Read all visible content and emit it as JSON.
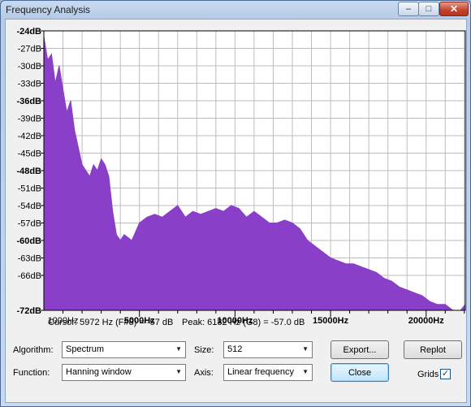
{
  "window": {
    "title": "Frequency Analysis",
    "min_glyph": "–",
    "max_glyph": "□",
    "close_glyph": "✕"
  },
  "chart_data": {
    "type": "area",
    "y_tick_labels": [
      "-24dB",
      "-27dB",
      "-30dB",
      "-33dB",
      "-36dB",
      "-39dB",
      "-42dB",
      "-45dB",
      "-48dB",
      "-51dB",
      "-54dB",
      "-57dB",
      "-60dB",
      "-63dB",
      "-66dB",
      "-72dB"
    ],
    "x_tick_labels": [
      "1000Hz",
      "5000Hz",
      "10000Hz",
      "15000Hz",
      "20000Hz"
    ],
    "ylim": [
      -72,
      -24
    ],
    "xlim": [
      0,
      22050
    ],
    "grid": true,
    "color": "#8a3fc8",
    "x": [
      0,
      200,
      400,
      600,
      800,
      1000,
      1200,
      1400,
      1600,
      1800,
      2000,
      2200,
      2400,
      2600,
      2800,
      3000,
      3200,
      3400,
      3600,
      3800,
      4000,
      4200,
      4400,
      4600,
      4800,
      5000,
      5400,
      5800,
      6200,
      6600,
      7000,
      7400,
      7800,
      8200,
      8600,
      9000,
      9400,
      9800,
      10200,
      10600,
      11000,
      11400,
      11800,
      12200,
      12600,
      13000,
      13400,
      13800,
      14200,
      14600,
      15000,
      15400,
      15800,
      16200,
      16600,
      17000,
      17400,
      17800,
      18200,
      18600,
      19000,
      19400,
      19800,
      20200,
      20600,
      21000,
      21400,
      21800,
      22050
    ],
    "y": [
      -25,
      -29,
      -28,
      -33,
      -30,
      -34,
      -38,
      -36,
      -41,
      -44,
      -47,
      -48,
      -49,
      -47,
      -48,
      -46,
      -47,
      -49,
      -55,
      -59,
      -60,
      -59,
      -59.5,
      -60,
      -58.5,
      -57,
      -56,
      -55.5,
      -56,
      -55,
      -54,
      -56,
      -55,
      -55.5,
      -55,
      -54.5,
      -55,
      -54,
      -54.5,
      -56,
      -55,
      -56,
      -57,
      -57,
      -56.5,
      -57,
      -58,
      -60,
      -61,
      -62,
      -63,
      -63.5,
      -64,
      -64,
      -64.5,
      -65,
      -65.5,
      -66.5,
      -67,
      -68,
      -68.5,
      -69,
      -69.5,
      -70.5,
      -71,
      -71,
      -72,
      -72,
      -71
    ]
  },
  "status": {
    "cursor": "Cursor: 5972 Hz (F#8) = -57 dB",
    "peak": "Peak: 6182 Hz (G8) = -57.0 dB"
  },
  "controls": {
    "algorithm_label": "Algorithm:",
    "algorithm_value": "Spectrum",
    "size_label": "Size:",
    "size_value": "512",
    "export_label": "Export...",
    "replot_label": "Replot",
    "function_label": "Function:",
    "function_value": "Hanning window",
    "axis_label": "Axis:",
    "axis_value": "Linear frequency",
    "close_label": "Close",
    "grids_label": "Grids",
    "grids_checked": true,
    "check_glyph": "✓"
  }
}
